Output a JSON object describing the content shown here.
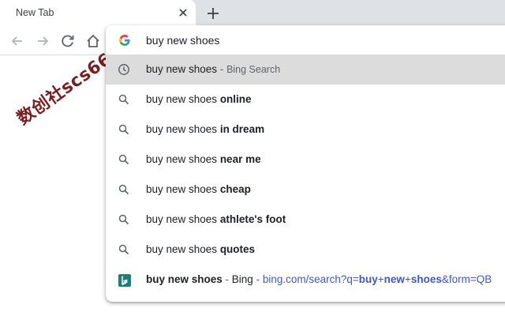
{
  "tab": {
    "title": "New Tab",
    "close_icon": "close-icon"
  },
  "toolbar": {
    "back_icon": "back-arrow-icon",
    "forward_icon": "forward-arrow-icon",
    "reload_icon": "reload-icon",
    "home_icon": "home-icon"
  },
  "omnibox": {
    "query": "buy new shoes",
    "search_engine_icon": "google-g-icon",
    "suggestions": [
      {
        "icon": "clock-icon",
        "prefix": "buy new shoes",
        "bold": "",
        "separator": " - ",
        "secondary": "Bing Search",
        "selected": true
      },
      {
        "icon": "search-icon",
        "prefix": "buy new shoes ",
        "bold": "online"
      },
      {
        "icon": "search-icon",
        "prefix": "buy new shoes ",
        "bold": "in dream"
      },
      {
        "icon": "search-icon",
        "prefix": "buy new shoes ",
        "bold": "near me"
      },
      {
        "icon": "search-icon",
        "prefix": "buy new shoes ",
        "bold": "cheap"
      },
      {
        "icon": "search-icon",
        "prefix": "buy new shoes ",
        "bold": "athlete's foot"
      },
      {
        "icon": "search-icon",
        "prefix": "buy new shoes ",
        "bold": "quotes"
      }
    ],
    "bookmark_suggestion": {
      "icon": "bing-logo-icon",
      "title": "buy new shoes",
      "separator": " - ",
      "site": "Bing",
      "url_sep": " - ",
      "url_a": "bing.com/search?q=",
      "url_b1": "buy",
      "url_plus1": "+",
      "url_b2": "new",
      "url_plus2": "+",
      "url_b3": "shoes",
      "url_tail": "&form=QB"
    }
  },
  "watermark": "数创社scs66"
}
